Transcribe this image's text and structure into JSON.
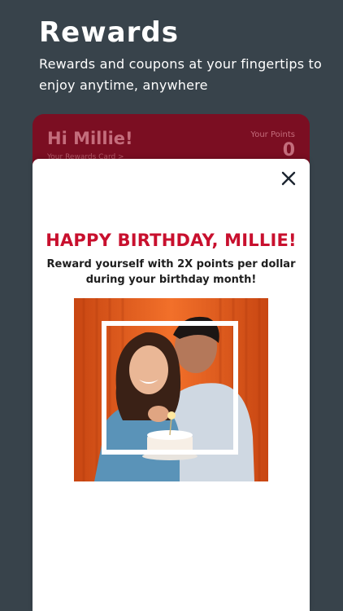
{
  "promo": {
    "title": "Rewards",
    "subtitle": "Rewards and coupons at your fingertips to enjoy anytime, anywhere"
  },
  "card": {
    "greeting": "Hi Millie!",
    "link": "Your Rewards Card >",
    "points_label": "Your Points",
    "points_value": "0"
  },
  "modal": {
    "heading": "HAPPY BIRTHDAY, MILLIE!",
    "body": "Reward yourself with 2X points per dollar during your birthday month!",
    "close_icon": "close-icon",
    "image": "birthday-couple-photo"
  },
  "colors": {
    "background": "#38434b",
    "card": "#7b0e22",
    "heading": "#c8102e",
    "photo_backdrop": "#e55a1c"
  }
}
